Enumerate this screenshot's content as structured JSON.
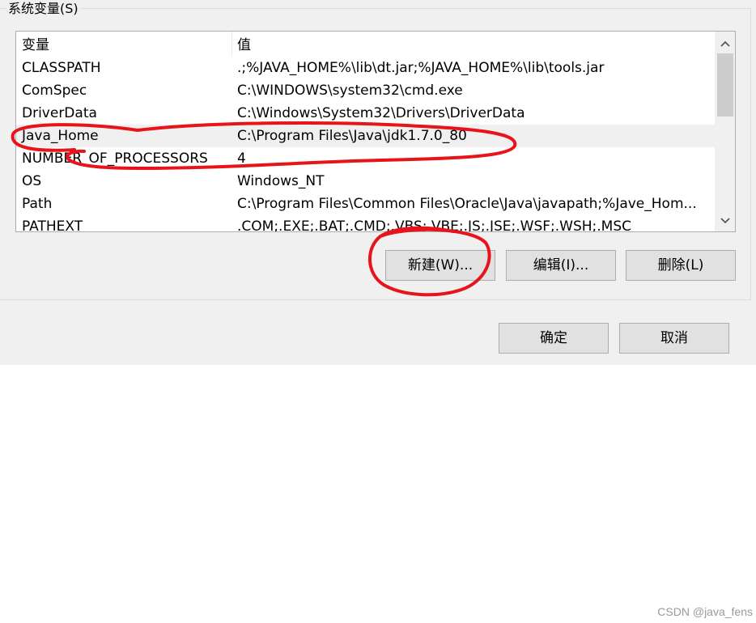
{
  "group": {
    "title": "系统变量(S)"
  },
  "list": {
    "headers": {
      "name": "变量",
      "value": "值"
    },
    "rows": [
      {
        "name": "CLASSPATH",
        "value": ".;%JAVA_HOME%\\lib\\dt.jar;%JAVA_HOME%\\lib\\tools.jar"
      },
      {
        "name": "ComSpec",
        "value": "C:\\WINDOWS\\system32\\cmd.exe"
      },
      {
        "name": "DriverData",
        "value": "C:\\Windows\\System32\\Drivers\\DriverData"
      },
      {
        "name": "Java_Home",
        "value": "C:\\Program Files\\Java\\jdk1.7.0_80"
      },
      {
        "name": "NUMBER_OF_PROCESSORS",
        "value": "4"
      },
      {
        "name": "OS",
        "value": "Windows_NT"
      },
      {
        "name": "Path",
        "value": "C:\\Program Files\\Common Files\\Oracle\\Java\\javapath;%Jave_Hom..."
      },
      {
        "name": "PATHEXT",
        "value": ".COM;.EXE;.BAT;.CMD;.VBS;.VBE;.JS;.JSE;.WSF;.WSH;.MSC"
      }
    ],
    "selected_row_index": 3
  },
  "buttons": {
    "new": "新建(W)...",
    "edit": "编辑(I)...",
    "delete": "删除(L)",
    "ok": "确定",
    "cancel": "取消"
  },
  "icons": {
    "scroll_up": "chevron-up-icon",
    "scroll_down": "chevron-down-icon"
  },
  "colors": {
    "dialog_bg": "#f0f0f0",
    "annotation": "#e8141b",
    "button_bg": "#e1e1e1",
    "selected_row": "#f0f0f0"
  },
  "watermark": "CSDN @java_fens"
}
